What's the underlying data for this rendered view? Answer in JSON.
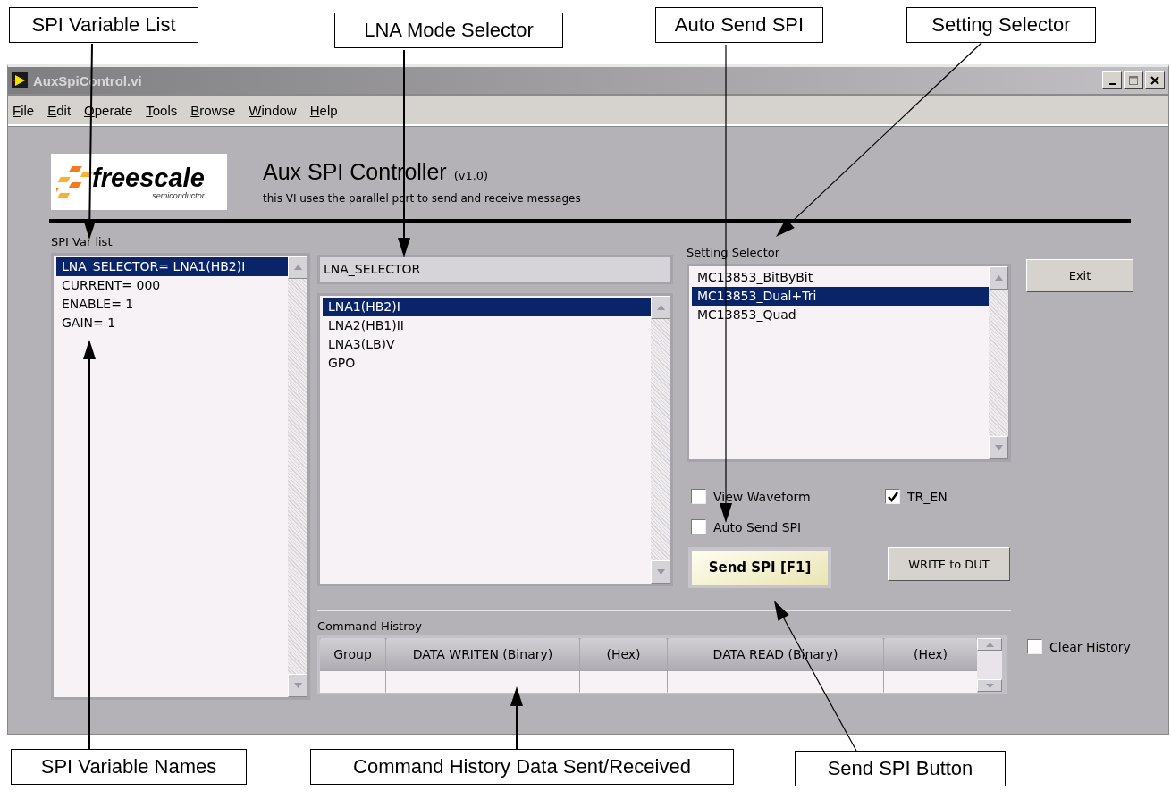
{
  "top_callouts": [
    "SPI Variable List",
    "LNA Mode Selector",
    "Auto Send SPI",
    "Setting Selector"
  ],
  "bottom_callouts": [
    "SPI Variable Names",
    "Command History Data Sent/Received",
    "Send SPI Button"
  ],
  "window": {
    "title": "AuxSpiControl.vi"
  },
  "menu": [
    "File",
    "Edit",
    "Operate",
    "Tools",
    "Browse",
    "Window",
    "Help"
  ],
  "logo": {
    "name": "freescale",
    "tagline": "semiconductor"
  },
  "header": {
    "title": "Aux SPI Controller",
    "version": "(v1.0)",
    "subtitle": "this VI uses the parallel port to send and receive messages"
  },
  "spi_var_list": {
    "label": "SPI Var list",
    "items": [
      {
        "text": "LNA_SELECTOR= LNA1(HB2)I",
        "selected": true
      },
      {
        "text": "CURRENT= 000",
        "selected": false
      },
      {
        "text": "ENABLE= 1",
        "selected": false
      },
      {
        "text": "GAIN= 1",
        "selected": false
      }
    ]
  },
  "lna_selector": {
    "value": "LNA_SELECTOR",
    "items": [
      {
        "text": "LNA1(HB2)I",
        "selected": true
      },
      {
        "text": "LNA2(HB1)II",
        "selected": false
      },
      {
        "text": "LNA3(LB)V",
        "selected": false
      },
      {
        "text": "GPO",
        "selected": false
      }
    ]
  },
  "setting_selector": {
    "label": "Setting Selector",
    "items": [
      {
        "text": "MC13853_BitByBit",
        "selected": false
      },
      {
        "text": "MC13853_Dual+Tri",
        "selected": true
      },
      {
        "text": "MC13853_Quad",
        "selected": false
      }
    ]
  },
  "checkboxes": [
    {
      "label": "View Waveform",
      "checked": false
    },
    {
      "label": "TR_EN",
      "checked": true
    },
    {
      "label": "Auto Send SPI",
      "checked": false
    }
  ],
  "buttons": {
    "send": "Send SPI [F1]",
    "write": "WRITE to DUT",
    "exit": "Exit"
  },
  "command_history": {
    "label": "Command Histroy",
    "columns": [
      "Group",
      "DATA WRITEN (Binary)",
      "(Hex)",
      "DATA READ (Binary)",
      "(Hex)"
    ]
  },
  "clear_history": {
    "label": "Clear History",
    "checked": false
  }
}
